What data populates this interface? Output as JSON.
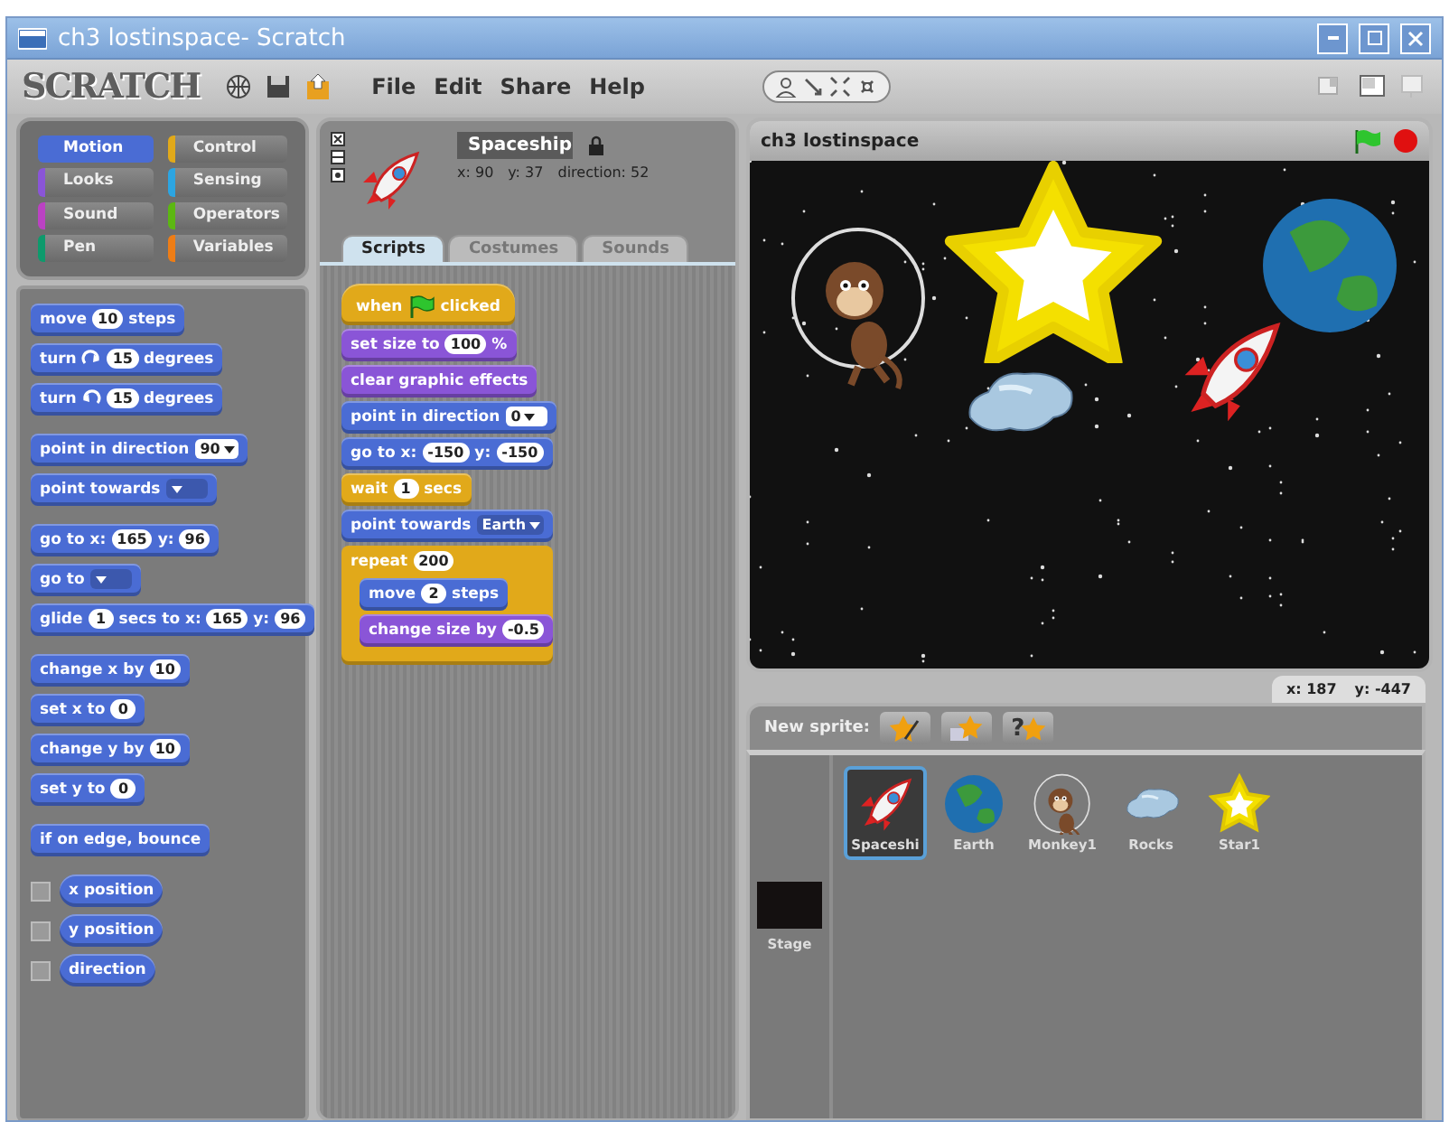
{
  "window": {
    "title": "ch3 lostinspace- Scratch"
  },
  "menu": [
    "File",
    "Edit",
    "Share",
    "Help"
  ],
  "logo": "SCRATCH",
  "categories": [
    {
      "label": "Motion",
      "color": "#4a6cd4",
      "selected": true
    },
    {
      "label": "Control",
      "color": "#e1a91a",
      "selected": false
    },
    {
      "label": "Looks",
      "color": "#8a55d7",
      "selected": false
    },
    {
      "label": "Sensing",
      "color": "#2ca5e2",
      "selected": false
    },
    {
      "label": "Sound",
      "color": "#bb42c3",
      "selected": false
    },
    {
      "label": "Operators",
      "color": "#5cb712",
      "selected": false
    },
    {
      "label": "Pen",
      "color": "#0e9a6c",
      "selected": false
    },
    {
      "label": "Variables",
      "color": "#ee7d16",
      "selected": false
    }
  ],
  "palette": [
    [
      {
        "kind": "stack",
        "color": "#4a6cd4",
        "parts": [
          {
            "kind": "text",
            "text": "move"
          },
          {
            "kind": "number",
            "text": "10"
          },
          {
            "kind": "text",
            "text": "steps"
          }
        ]
      },
      {
        "kind": "stack",
        "color": "#4a6cd4",
        "parts": [
          {
            "kind": "text",
            "text": "turn"
          },
          {
            "kind": "cw_icon"
          },
          {
            "kind": "number",
            "text": "15"
          },
          {
            "kind": "text",
            "text": "degrees"
          }
        ]
      },
      {
        "kind": "stack",
        "color": "#4a6cd4",
        "parts": [
          {
            "kind": "text",
            "text": "turn"
          },
          {
            "kind": "ccw_icon"
          },
          {
            "kind": "number",
            "text": "15"
          },
          {
            "kind": "text",
            "text": "degrees"
          }
        ]
      }
    ],
    [
      {
        "kind": "stack",
        "color": "#4a6cd4",
        "parts": [
          {
            "kind": "text",
            "text": "point in direction"
          },
          {
            "kind": "dropdown",
            "text": "90"
          }
        ]
      },
      {
        "kind": "stack",
        "color": "#4a6cd4",
        "parts": [
          {
            "kind": "text",
            "text": "point towards"
          },
          {
            "kind": "dropdown"
          }
        ]
      }
    ],
    [
      {
        "kind": "stack",
        "color": "#4a6cd4",
        "parts": [
          {
            "kind": "text",
            "text": "go to x:"
          },
          {
            "kind": "number",
            "text": "165"
          },
          {
            "kind": "text",
            "text": "y:"
          },
          {
            "kind": "number",
            "text": "96"
          }
        ]
      },
      {
        "kind": "stack",
        "color": "#4a6cd4",
        "parts": [
          {
            "kind": "text",
            "text": "go to"
          },
          {
            "kind": "dropdown"
          }
        ]
      },
      {
        "kind": "stack",
        "color": "#4a6cd4",
        "parts": [
          {
            "kind": "text",
            "text": "glide"
          },
          {
            "kind": "number",
            "text": "1"
          },
          {
            "kind": "text",
            "text": "secs to x:"
          },
          {
            "kind": "number",
            "text": "165"
          },
          {
            "kind": "text",
            "text": "y:"
          },
          {
            "kind": "number",
            "text": "96"
          }
        ]
      }
    ],
    [
      {
        "kind": "stack",
        "color": "#4a6cd4",
        "parts": [
          {
            "kind": "text",
            "text": "change x by"
          },
          {
            "kind": "number",
            "text": "10"
          }
        ]
      },
      {
        "kind": "stack",
        "color": "#4a6cd4",
        "parts": [
          {
            "kind": "text",
            "text": "set x to"
          },
          {
            "kind": "number",
            "text": "0"
          }
        ]
      },
      {
        "kind": "stack",
        "color": "#4a6cd4",
        "parts": [
          {
            "kind": "text",
            "text": "change y by"
          },
          {
            "kind": "number",
            "text": "10"
          }
        ]
      },
      {
        "kind": "stack",
        "color": "#4a6cd4",
        "parts": [
          {
            "kind": "text",
            "text": "set y to"
          },
          {
            "kind": "number",
            "text": "0"
          }
        ]
      }
    ],
    [
      {
        "kind": "stack",
        "color": "#4a6cd4",
        "parts": [
          {
            "kind": "text",
            "text": "if on edge, bounce"
          }
        ]
      }
    ],
    [
      {
        "kind": "reporter",
        "color": "#4a6cd4",
        "checked": false,
        "parts": [
          {
            "kind": "text",
            "text": "x position"
          }
        ]
      },
      {
        "kind": "reporter",
        "color": "#4a6cd4",
        "checked": false,
        "parts": [
          {
            "kind": "text",
            "text": "y position"
          }
        ]
      },
      {
        "kind": "reporter",
        "color": "#4a6cd4",
        "checked": false,
        "parts": [
          {
            "kind": "text",
            "text": "direction"
          }
        ]
      }
    ]
  ],
  "sprite": {
    "name": "Spaceship",
    "x": "x: 90",
    "y": "y: 37",
    "direction": "direction: 52"
  },
  "tabs": [
    {
      "label": "Scripts",
      "selected": true
    },
    {
      "label": "Costumes",
      "selected": false
    },
    {
      "label": "Sounds",
      "selected": false
    }
  ],
  "script": [
    {
      "kind": "hat",
      "color": "#e1a91a",
      "parts": [
        {
          "kind": "text",
          "text": "when"
        },
        {
          "kind": "flag_icon"
        },
        {
          "kind": "text",
          "text": "clicked"
        }
      ]
    },
    {
      "kind": "stack",
      "color": "#8a55d7",
      "parts": [
        {
          "kind": "text",
          "text": "set size to"
        },
        {
          "kind": "number",
          "text": "100"
        },
        {
          "kind": "text",
          "text": "%"
        }
      ]
    },
    {
      "kind": "stack",
      "color": "#8a55d7",
      "parts": [
        {
          "kind": "text",
          "text": "clear graphic effects"
        }
      ]
    },
    {
      "kind": "stack",
      "color": "#4a6cd4",
      "parts": [
        {
          "kind": "text",
          "text": "point in direction"
        },
        {
          "kind": "dropdown",
          "text": "0"
        }
      ]
    },
    {
      "kind": "stack",
      "color": "#4a6cd4",
      "parts": [
        {
          "kind": "text",
          "text": "go to x:"
        },
        {
          "kind": "number",
          "text": "-150"
        },
        {
          "kind": "text",
          "text": "y:"
        },
        {
          "kind": "number",
          "text": "-150"
        }
      ]
    },
    {
      "kind": "stack",
      "color": "#e1a91a",
      "parts": [
        {
          "kind": "text",
          "text": "wait"
        },
        {
          "kind": "number",
          "text": "1"
        },
        {
          "kind": "text",
          "text": "secs"
        }
      ]
    },
    {
      "kind": "stack",
      "color": "#4a6cd4",
      "parts": [
        {
          "kind": "text",
          "text": "point towards"
        },
        {
          "kind": "dropdown",
          "text": "Earth"
        }
      ]
    },
    {
      "kind": "c",
      "color": "#e1a91a",
      "parts": [
        {
          "kind": "text",
          "text": "repeat"
        },
        {
          "kind": "number",
          "text": "200"
        }
      ],
      "children": [
        {
          "kind": "stack",
          "color": "#4a6cd4",
          "parts": [
            {
              "kind": "text",
              "text": "move"
            },
            {
              "kind": "number",
              "text": "2"
            },
            {
              "kind": "text",
              "text": "steps"
            }
          ]
        },
        {
          "kind": "stack",
          "color": "#8a55d7",
          "parts": [
            {
              "kind": "text",
              "text": "change size by"
            },
            {
              "kind": "number",
              "text": "-0.5"
            }
          ]
        }
      ]
    }
  ],
  "stage": {
    "title": "ch3 lostinspace",
    "mouse_x": "x: 187",
    "mouse_y": "y: -447"
  },
  "new_sprite_label": "New sprite:",
  "random_sprite_glyph": "?",
  "sprites": [
    {
      "name": "Spaceshi",
      "kind": "rocket",
      "selected": true
    },
    {
      "name": "Earth",
      "kind": "planet",
      "selected": false
    },
    {
      "name": "Monkey1",
      "kind": "monkey",
      "selected": false
    },
    {
      "name": "Rocks",
      "kind": "rock",
      "selected": false
    },
    {
      "name": "Star1",
      "kind": "star",
      "selected": false
    }
  ],
  "stage_thumb": {
    "label": "Stage"
  }
}
